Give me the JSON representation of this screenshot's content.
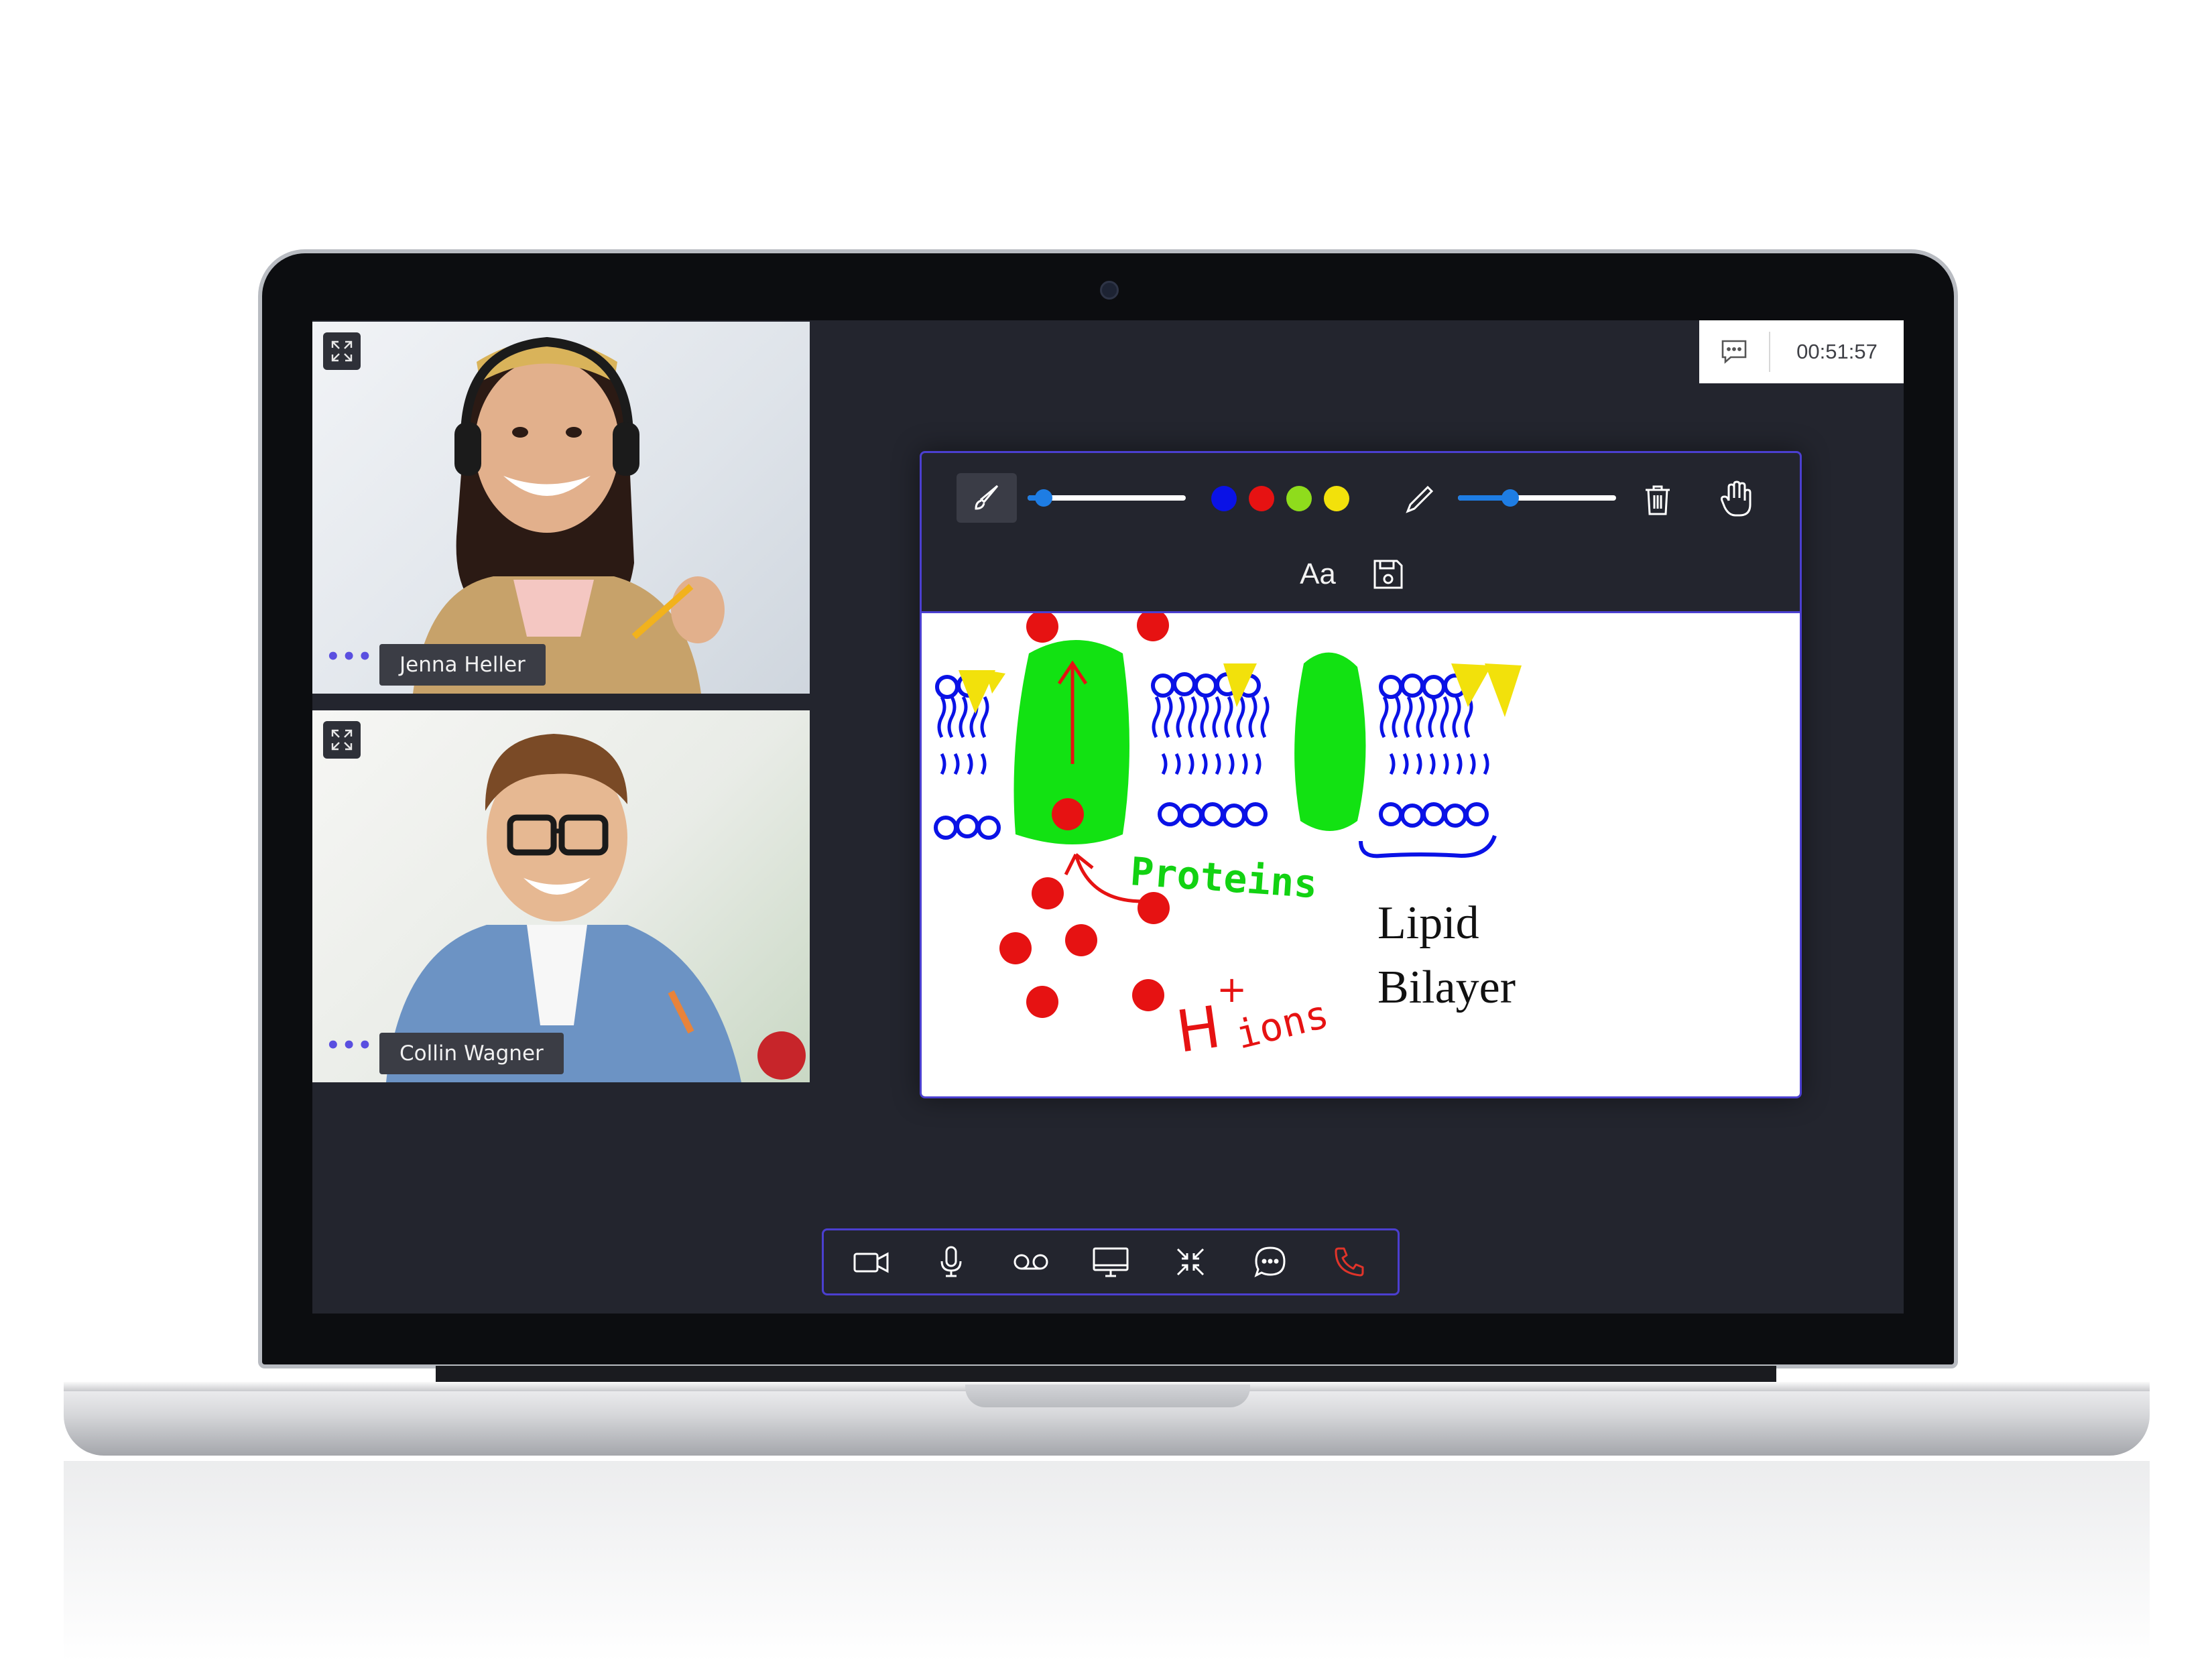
{
  "participants": [
    {
      "name": "Jenna Heller"
    },
    {
      "name": "Collin Wagner"
    }
  ],
  "session": {
    "timer": "00:51:57"
  },
  "whiteboard": {
    "text_tool_label": "Aa",
    "brush_size": 0.1,
    "pen_size": 0.33,
    "colors": [
      "#0a12e6",
      "#e61212",
      "#8fdc1c",
      "#f2e10b"
    ],
    "labels": {
      "proteins": "Proteins",
      "ions_h": "H",
      "ions_plus": "+",
      "ions_text": "ions",
      "lipid_line1": "Lipid",
      "lipid_line2": "Bilayer"
    }
  },
  "controls": [
    "video-camera-icon",
    "microphone-icon",
    "voicemail-record-icon",
    "screen-share-icon",
    "minimize-icon",
    "chat-icon",
    "end-call-icon"
  ],
  "theme": {
    "accent": "#4b3fd0",
    "slider": "#1e7de4",
    "end_call": "#e0342a",
    "background": "#23252e"
  }
}
